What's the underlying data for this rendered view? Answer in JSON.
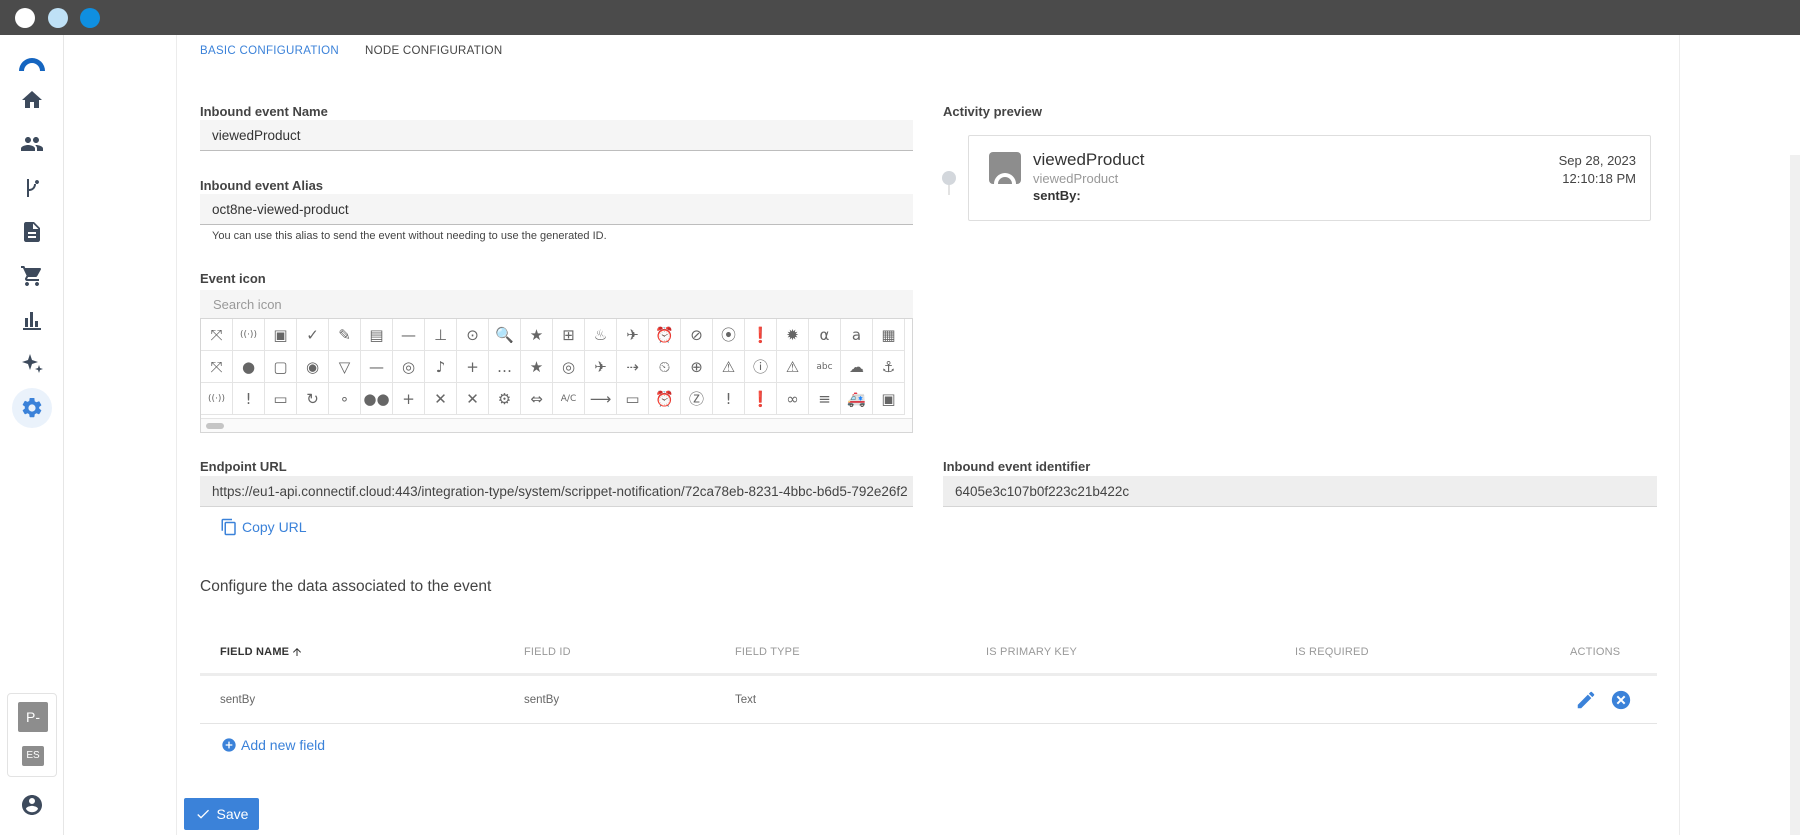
{
  "account": {
    "avatar_letter": "P-",
    "locale": "ES"
  },
  "tabs": [
    {
      "label": "BASIC CONFIGURATION",
      "active": true
    },
    {
      "label": "NODE CONFIGURATION",
      "active": false
    }
  ],
  "form": {
    "name_label": "Inbound event Name",
    "name_value": "viewedProduct",
    "alias_label": "Inbound event Alias",
    "alias_value": "oct8ne-viewed-product",
    "alias_helper": "You can use this alias to send the event without needing to use the generated ID.",
    "icon_label": "Event icon",
    "icon_search_placeholder": "Search icon",
    "endpoint_label": "Endpoint URL",
    "endpoint_value": "https://eu1-api.connectif.cloud:443/integration-type/system/scrippet-notification/72ca78eb-8231-4bbc-b6d5-792e26f2",
    "copy_url_label": "Copy URL",
    "identifier_label": "Inbound event identifier",
    "identifier_value": "6405e3c107b0f223c21b422c"
  },
  "preview": {
    "label": "Activity preview",
    "title": "viewedProduct",
    "subtitle": "viewedProduct",
    "property": "sentBy:",
    "date": "Sep 28, 2023",
    "time": "12:10:18 PM"
  },
  "data_section": {
    "title": "Configure the data associated to the event",
    "columns": {
      "field_name": "FIELD NAME",
      "field_id": "FIELD ID",
      "field_type": "FIELD TYPE",
      "is_primary_key": "IS PRIMARY KEY",
      "is_required": "IS REQUIRED",
      "actions": "ACTIONS"
    },
    "rows": [
      {
        "field_name": "sentBy",
        "field_id": "sentBy",
        "field_type": "Text"
      }
    ],
    "add_label": "Add new field"
  },
  "save_label": "Save",
  "icon_grid": {
    "row1": [
      "⤧",
      "((·))",
      "▣",
      "✓",
      "✎",
      "▤",
      "—",
      "⊥",
      "⊙",
      "🔍",
      "★",
      "⊞",
      "♨",
      "✈",
      "⏰",
      "⊘",
      "⦿",
      "❗",
      "✹",
      "α",
      "a",
      "▦"
    ],
    "row2": [
      "⤧",
      "●",
      "▢",
      "◉",
      "▽",
      "—",
      "◎",
      "♪",
      "+",
      "…",
      "★",
      "◎",
      "✈",
      "⇢",
      "⏲",
      "⊕",
      "⚠",
      "ⓘ",
      "⚠",
      "abc",
      "☁",
      "⚓"
    ],
    "row3": [
      "((·))",
      "!",
      "▭",
      "↻",
      "∘",
      "●●",
      "+",
      "✕",
      "✕",
      "⚙",
      "⇔",
      "A/C",
      "⟶",
      "▭",
      "⏰",
      "Ⓩ",
      "!",
      "❗",
      "∞",
      "≡",
      "🚑",
      "▣"
    ]
  },
  "colors": {
    "accent": "#3b82d9",
    "danger": "#3b82d9"
  }
}
